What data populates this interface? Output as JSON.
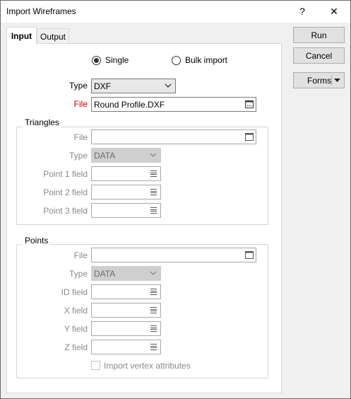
{
  "window": {
    "title": "Import Wireframes",
    "help": "?",
    "close": "✕"
  },
  "tabs": [
    {
      "label": "Input"
    },
    {
      "label": "Output"
    }
  ],
  "mode": {
    "single_label": "Single",
    "bulk_label": "Bulk import",
    "selected": "Single"
  },
  "main": {
    "type_label": "Type",
    "type_value": "DXF",
    "file_label": "File",
    "file_value": "Round Profile.DXF"
  },
  "triangles": {
    "title": "Triangles",
    "file_label": "File",
    "file_value": "",
    "type_label": "Type",
    "type_value": "DATA",
    "p1_label": "Point 1 field",
    "p2_label": "Point 2 field",
    "p3_label": "Point 3 field"
  },
  "points": {
    "title": "Points",
    "file_label": "File",
    "file_value": "",
    "type_label": "Type",
    "type_value": "DATA",
    "id_label": "ID field",
    "x_label": "X field",
    "y_label": "Y field",
    "z_label": "Z field",
    "vertex_label": "Import vertex attributes",
    "vertex_checked": false
  },
  "buttons": {
    "run": "Run",
    "cancel": "Cancel",
    "forms": "Forms"
  },
  "colors": {
    "required_label": "#c00000",
    "disabled_text": "#8a8a8a"
  },
  "icons": {
    "folder": "folder-icon",
    "list": "list-icon",
    "dropdown": "chevron-down-icon"
  }
}
